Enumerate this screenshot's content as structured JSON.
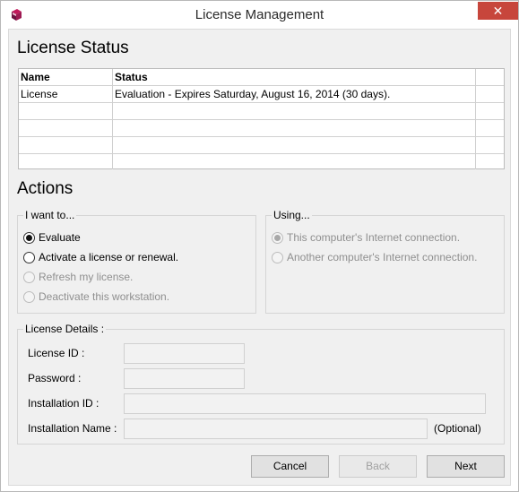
{
  "window": {
    "title": "License Management",
    "close_glyph": "✕",
    "app_icon": "app-book-icon",
    "close_color": "#c7463c"
  },
  "license_status": {
    "heading": "License Status",
    "columns": [
      "Name",
      "Status"
    ],
    "rows": [
      {
        "name": "License",
        "status": "Evaluation - Expires Saturday, August 16, 2014 (30 days)."
      }
    ]
  },
  "actions": {
    "heading": "Actions",
    "i_want_to": {
      "legend": "I want to...",
      "options": [
        {
          "label": "Evaluate",
          "checked": true,
          "enabled": true
        },
        {
          "label": "Activate a license or renewal.",
          "checked": false,
          "enabled": true
        },
        {
          "label": "Refresh my license.",
          "checked": false,
          "enabled": false
        },
        {
          "label": "Deactivate this workstation.",
          "checked": false,
          "enabled": false
        }
      ]
    },
    "using": {
      "legend": "Using...",
      "options": [
        {
          "label": "This computer's Internet connection.",
          "checked": true,
          "enabled": false
        },
        {
          "label": "Another computer's Internet connection.",
          "checked": false,
          "enabled": false
        }
      ]
    }
  },
  "license_details": {
    "legend": "License Details :",
    "license_id_label": "License ID :",
    "license_id_value": "",
    "password_label": "Password :",
    "password_value": "",
    "installation_id_label": "Installation ID :",
    "installation_id_value": "",
    "installation_name_label": "Installation Name :",
    "installation_name_value": "",
    "optional_note": "(Optional)"
  },
  "buttons": {
    "cancel": "Cancel",
    "back": "Back",
    "next": "Next"
  }
}
